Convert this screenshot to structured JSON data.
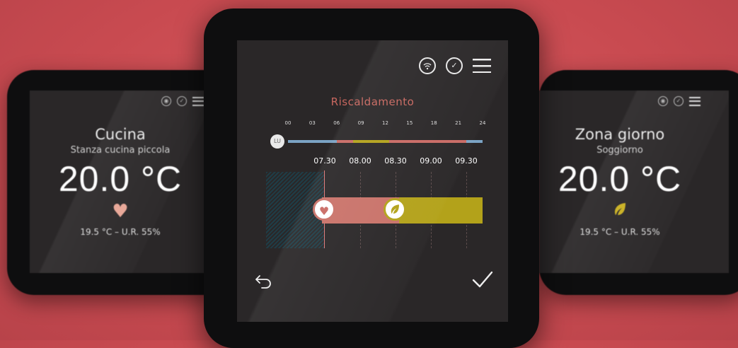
{
  "left_panel": {
    "zone_name": "Cucina",
    "room_name": "Stanza cucina piccola",
    "temperature": "20.0 °C",
    "mode_icon": "heart-icon",
    "info": "19.5 °C – U.R. 55%"
  },
  "right_panel": {
    "zone_name": "Zona giorno",
    "room_name": "Soggiorno",
    "temperature": "20.0 °C",
    "mode_icon": "leaf-icon",
    "info": "19.5 °C – U.R. 55%"
  },
  "main_panel": {
    "icons": [
      "wifi-icon",
      "chat-check-icon",
      "menu-icon"
    ],
    "title": "Riscaldamento",
    "hour_labels": [
      "00",
      "03",
      "06",
      "09",
      "12",
      "15",
      "18",
      "21",
      "24"
    ],
    "day_label": "LU",
    "time_labels": [
      "07.30",
      "08.00",
      "08.30",
      "09.00",
      "09.30"
    ],
    "day_segments": [
      {
        "from_hour": 0,
        "to_hour": 6,
        "mode": "eco",
        "color": "#7ba3c4"
      },
      {
        "from_hour": 6,
        "to_hour": 8,
        "mode": "comfort",
        "color": "#c96a64"
      },
      {
        "from_hour": 8,
        "to_hour": 12.5,
        "mode": "economy",
        "color": "#b3a21a"
      },
      {
        "from_hour": 12.5,
        "to_hour": 22,
        "mode": "comfort",
        "color": "#c96a64"
      },
      {
        "from_hour": 22,
        "to_hour": 24,
        "mode": "eco",
        "color": "#7ba3c4"
      }
    ],
    "back_icon": "undo-arrow-icon",
    "confirm_icon": "checkmark-icon"
  },
  "colors": {
    "background": "#d1545a",
    "comfort": "#c96a64",
    "economy": "#b3a21a",
    "eco": "#7ba3c4",
    "title": "#c8675f"
  }
}
